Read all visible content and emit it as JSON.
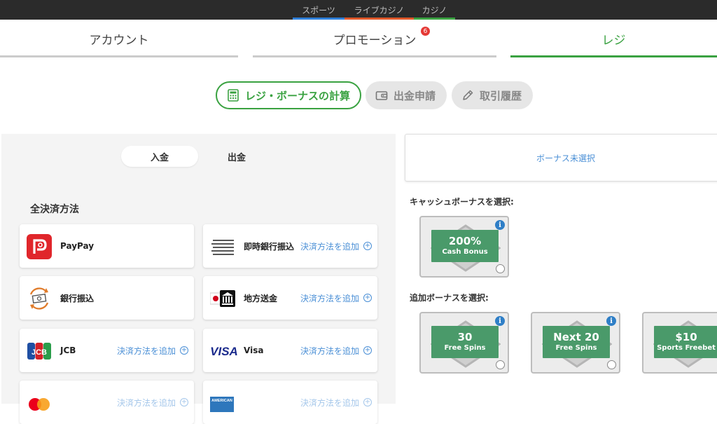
{
  "topnav": [
    {
      "label": "スポーツ",
      "color": "#2f7fd8"
    },
    {
      "label": "ライブカジノ",
      "color": "#e0582a"
    },
    {
      "label": "カジノ",
      "color": "#3aa241"
    }
  ],
  "tabs": [
    {
      "label": "アカウント"
    },
    {
      "label": "プロモーション",
      "badge": "6"
    },
    {
      "label": "レジ",
      "active": true
    }
  ],
  "subtabs": [
    {
      "label": "レジ・ボーナスの計算",
      "icon": "calculator-icon",
      "active": true
    },
    {
      "label": "出金申請",
      "icon": "wallet-icon"
    },
    {
      "label": "取引履歴",
      "icon": "pencil-icon"
    }
  ],
  "payment": {
    "deposit_label": "入金",
    "withdraw_label": "出金",
    "section_title": "全決済方法",
    "add_label": "決済方法を追加",
    "methods": [
      {
        "name": "PayPay",
        "logo": "paypay-logo"
      },
      {
        "name": "即時銀行振込",
        "logo": "instant-bank-logo",
        "add": true
      },
      {
        "name": "銀行振込",
        "logo": "bank-transfer-logo"
      },
      {
        "name": "地方送金",
        "logo": "local-remittance-logo",
        "add": true
      },
      {
        "name": "JCB",
        "logo": "jcb-logo",
        "add": true
      },
      {
        "name": "Visa",
        "logo": "visa-logo",
        "add": true
      },
      {
        "name": "",
        "logo": "mastercard-logo",
        "add": true
      },
      {
        "name": "",
        "logo": "amex-logo",
        "add": true
      }
    ],
    "amex_text": "AMERICAN"
  },
  "bonus": {
    "none_selected": "ボーナス未選択",
    "cash_title": "キャッシュボーナスを選択:",
    "extra_title": "追加ボーナスを選択:",
    "cash": [
      {
        "big": "200%",
        "small": "Cash Bonus"
      }
    ],
    "extra": [
      {
        "big": "30",
        "small": "Free Spins"
      },
      {
        "big": "Next 20",
        "small": "Free Spins"
      },
      {
        "big": "$10",
        "small": "Sports Freebet"
      }
    ],
    "info_glyph": "i"
  },
  "colors": {
    "accent": "#3aa241",
    "link": "#4a8fd6",
    "bonus_green": "#4a9a6a"
  }
}
